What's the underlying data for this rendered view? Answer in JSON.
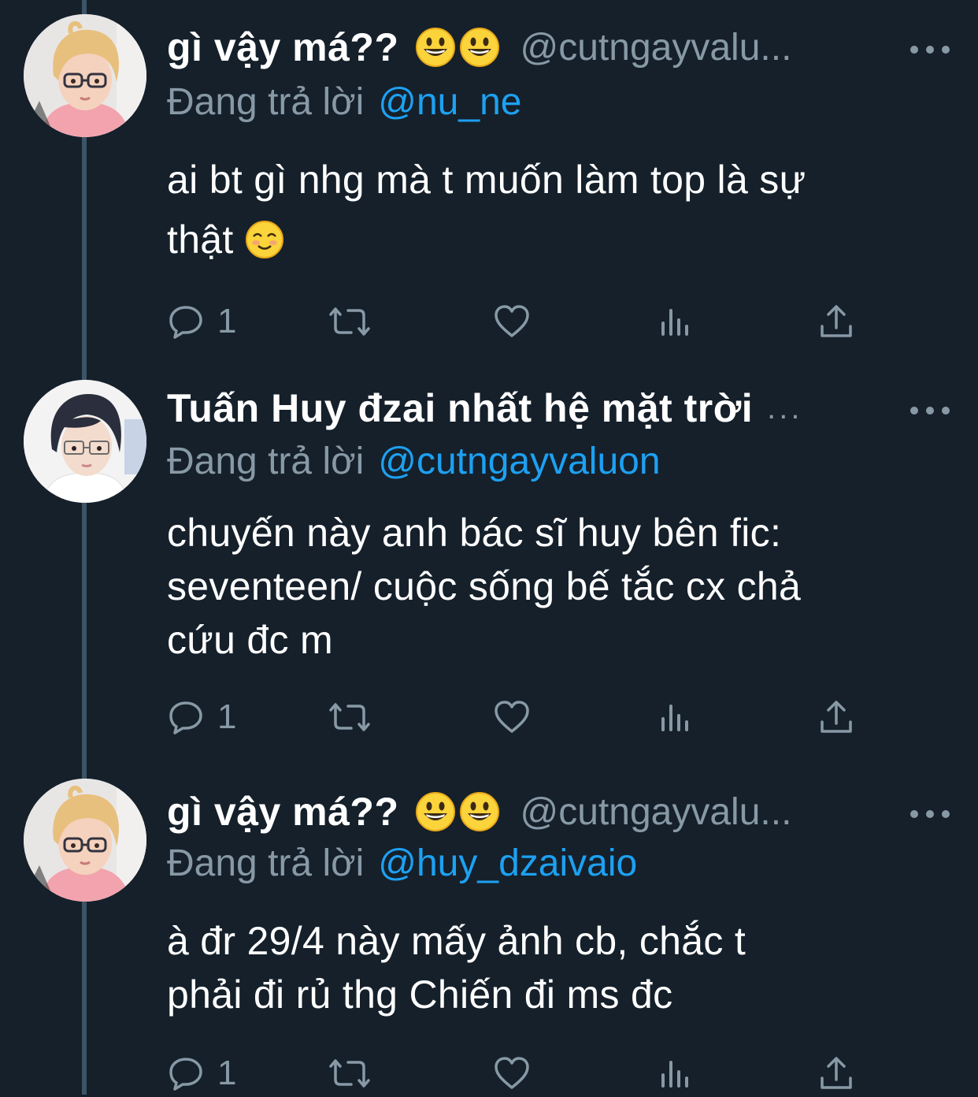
{
  "tweets": [
    {
      "display_name": "gì vậy má??",
      "handle": "@cutngayvaluon",
      "handle_shown": "@cutngayvalu...",
      "reply_prefix": "Đang trả lời",
      "reply_to": "@nu_ne",
      "text_lines": [
        "ai bt gì nhg mà t muốn làm top là sự",
        "thật"
      ],
      "reply_count": "1",
      "name_emojis": [
        "grinning-face-emoji",
        "grinning-face-emoji"
      ],
      "text_emoji": "smiling-face-emoji",
      "avatar": "blonde-boy-glasses-avatar"
    },
    {
      "display_name": "Tuấn Huy đzai nhất hệ mặt trời",
      "handle_shown": "...",
      "reply_prefix": "Đang trả lời",
      "reply_to": "@cutngayvaluon",
      "text_lines": [
        "chuyến này anh bác sĩ huy bên fic:",
        "seventeen/ cuộc sống bế tắc cx chả",
        "cứu đc m"
      ],
      "reply_count": "1",
      "avatar": "dark-hair-boy-glasses-avatar"
    },
    {
      "display_name": "gì vậy má??",
      "handle": "@cutngayvaluon",
      "handle_shown": "@cutngayvalu...",
      "reply_prefix": "Đang trả lời",
      "reply_to": "@huy_dzaivaio",
      "text_lines": [
        "à đr 29/4 này mấy ảnh cb, chắc t",
        "phải đi rủ thg Chiến đi ms đc"
      ],
      "reply_count": "1",
      "name_emojis": [
        "grinning-face-emoji",
        "grinning-face-emoji"
      ],
      "avatar": "blonde-boy-glasses-avatar"
    }
  ],
  "icons": {
    "reply": "reply-icon",
    "retweet": "retweet-icon",
    "like": "heart-icon",
    "analytics": "analytics-icon",
    "share": "share-icon",
    "more": "more-icon"
  },
  "colors": {
    "background": "#15202b",
    "secondary_text": "#8899a6",
    "link": "#1da1f2",
    "thread_line": "#3d5466"
  }
}
